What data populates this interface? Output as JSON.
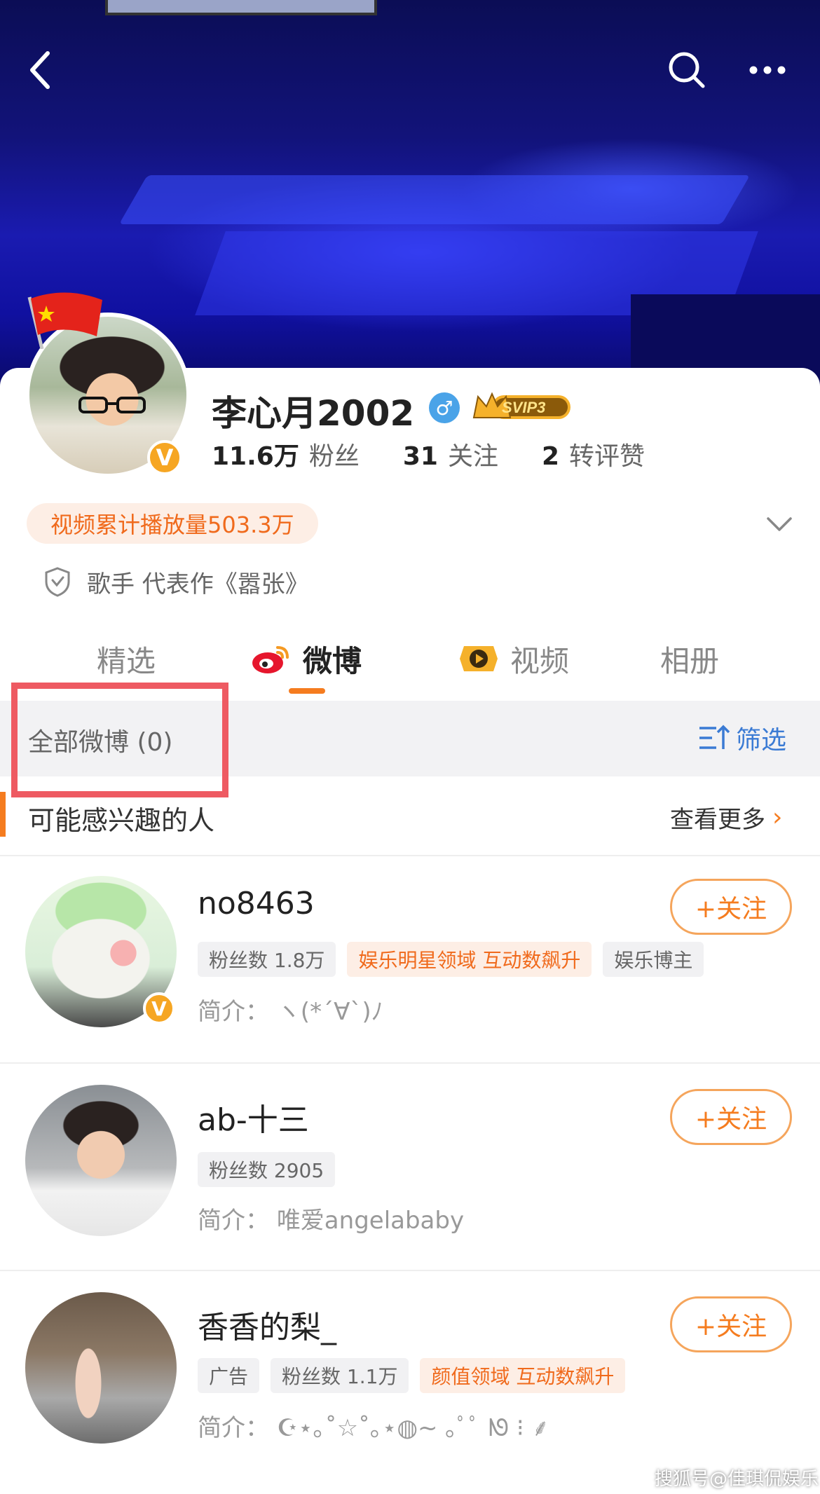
{
  "profile": {
    "name": "李心月2002",
    "svip": "SVIP3",
    "stats": [
      {
        "num": "11.6万",
        "label": "粉丝"
      },
      {
        "num": "31",
        "label": "关注"
      },
      {
        "num": "2",
        "label": "转评赞"
      }
    ],
    "play_tag": "视频累计播放量503.3万",
    "bio": "歌手 代表作《嚣张》"
  },
  "tabs": [
    {
      "label": "精选"
    },
    {
      "label": "微博"
    },
    {
      "label": "视频"
    },
    {
      "label": "相册"
    }
  ],
  "filter_bar": {
    "all_label": "全部微博 (0)",
    "filter_label": "筛选"
  },
  "recommend": {
    "title": "可能感兴趣的人",
    "more_label": "查看更多",
    "follow_label": "+关注",
    "users": [
      {
        "name": "no8463",
        "tags": [
          "粉丝数 1.8万",
          "娱乐明星领域 互动数飙升",
          "娱乐博主"
        ],
        "intro_label": "简介：",
        "intro": "ヽ(*´∀`)ﾉ"
      },
      {
        "name": "ab-十三",
        "tags": [
          "粉丝数 2905"
        ],
        "intro_label": "简介：",
        "intro": "唯爱angelababy"
      },
      {
        "name": "香香的梨_",
        "tags": [
          "广告",
          "粉丝数 1.1万",
          "颜值领域 互动数飙升"
        ],
        "intro_label": "简介：",
        "intro": "☪︎⋆｡˚☆˚｡⋆◍︎~ ｡ﾟﾟ ᘚ ⁝ ⸙"
      }
    ]
  },
  "watermark": "搜狐号@佳琪侃娱乐",
  "colors": {
    "accent": "#f57c1f",
    "link": "#3b7bd4",
    "highlight_box": "#ee5a62"
  },
  "icons": [
    "back-icon",
    "search-icon",
    "more-icon",
    "gender-male-icon",
    "svip-crown-icon",
    "chevron-down-icon",
    "shield-icon",
    "weibo-logo-icon",
    "video-icon",
    "filter-icon",
    "chevron-right-icon",
    "verified-v-icon",
    "china-flag-icon"
  ]
}
